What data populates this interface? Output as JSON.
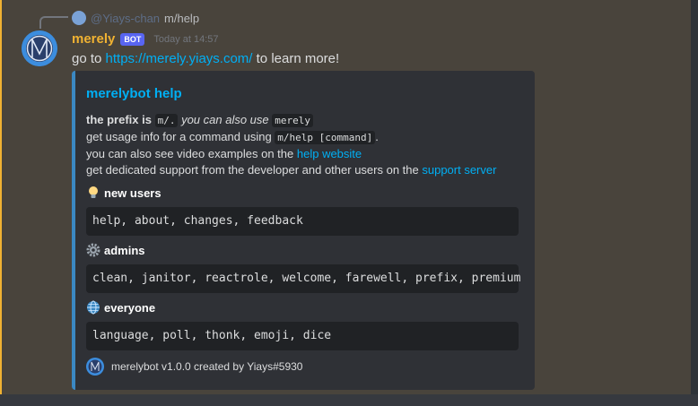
{
  "reply": {
    "username": "@Yiays-chan",
    "text": "m/help"
  },
  "message": {
    "username": "merely",
    "badge": "BOT",
    "timestamp": "Today at 14:57",
    "text_before": "go to ",
    "link": "https://merely.yiays.com/",
    "text_after": " to learn more!"
  },
  "embed": {
    "color": "#3b88c3",
    "title": "merelybot help",
    "desc": {
      "line1_bold": "the prefix is ",
      "line1_code": "m/.",
      "line1_italic": " you can also use ",
      "line1_code2": "merely",
      "line2_text": "get usage info for a command using ",
      "line2_code": "m/help [command]",
      "line2_end": ".",
      "line3_text": "you can also see video examples on the ",
      "line3_link": "help website",
      "line4_text": "get dedicated support from the developer and other users on the ",
      "line4_link": "support server"
    },
    "fields": [
      {
        "icon": "lightbulb-icon",
        "name": "new users",
        "value": "help, about, changes, feedback"
      },
      {
        "icon": "gear-icon",
        "name": "admins",
        "value": "clean, janitor, reactrole, welcome, farewell, prefix, premium"
      },
      {
        "icon": "globe-icon",
        "name": "everyone",
        "value": "language, poll, thonk, emoji, dice"
      }
    ],
    "footer": "merelybot v1.0.0 created by Yiays#5930"
  }
}
